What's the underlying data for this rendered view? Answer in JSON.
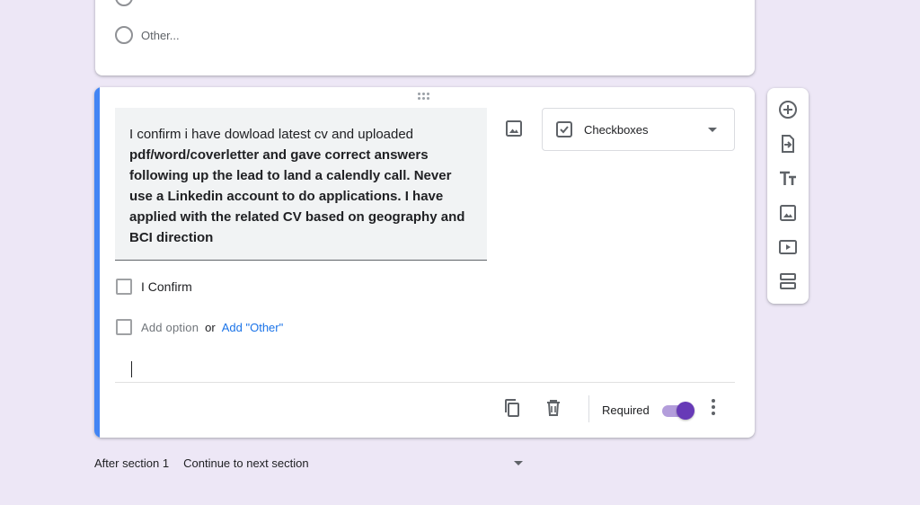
{
  "previous_question": {
    "other_option_label": "Other..."
  },
  "question": {
    "title_plain": "I confirm i have  dowload latest cv and uploaded ",
    "title_bold": "pdf/word/coverletter and gave correct answers following up the lead to land a calendly call. Never use a Linkedin account to do applications. I have applied with the related CV based on geography and BCI direction",
    "type": {
      "label": "Checkboxes",
      "icon": "checkbox-icon"
    },
    "options": [
      {
        "label": "I Confirm"
      }
    ],
    "add_option_label": "Add option",
    "or_label": "or",
    "add_other_label": "Add \"Other\"",
    "footer": {
      "duplicate_icon": "duplicate-icon",
      "delete_icon": "trash-icon",
      "required_label": "Required",
      "required_on": true
    }
  },
  "side_toolbar": {
    "icons": [
      "add-question-icon",
      "import-questions-icon",
      "add-title-icon",
      "add-image-icon",
      "add-video-icon",
      "add-section-icon"
    ]
  },
  "after_section": {
    "label": "After section 1",
    "value": "Continue to next section"
  },
  "colors": {
    "background": "#ede7f6",
    "accent_blue": "#4285f4",
    "toggle_purple": "#673ab7",
    "link_blue": "#1a73e8"
  }
}
